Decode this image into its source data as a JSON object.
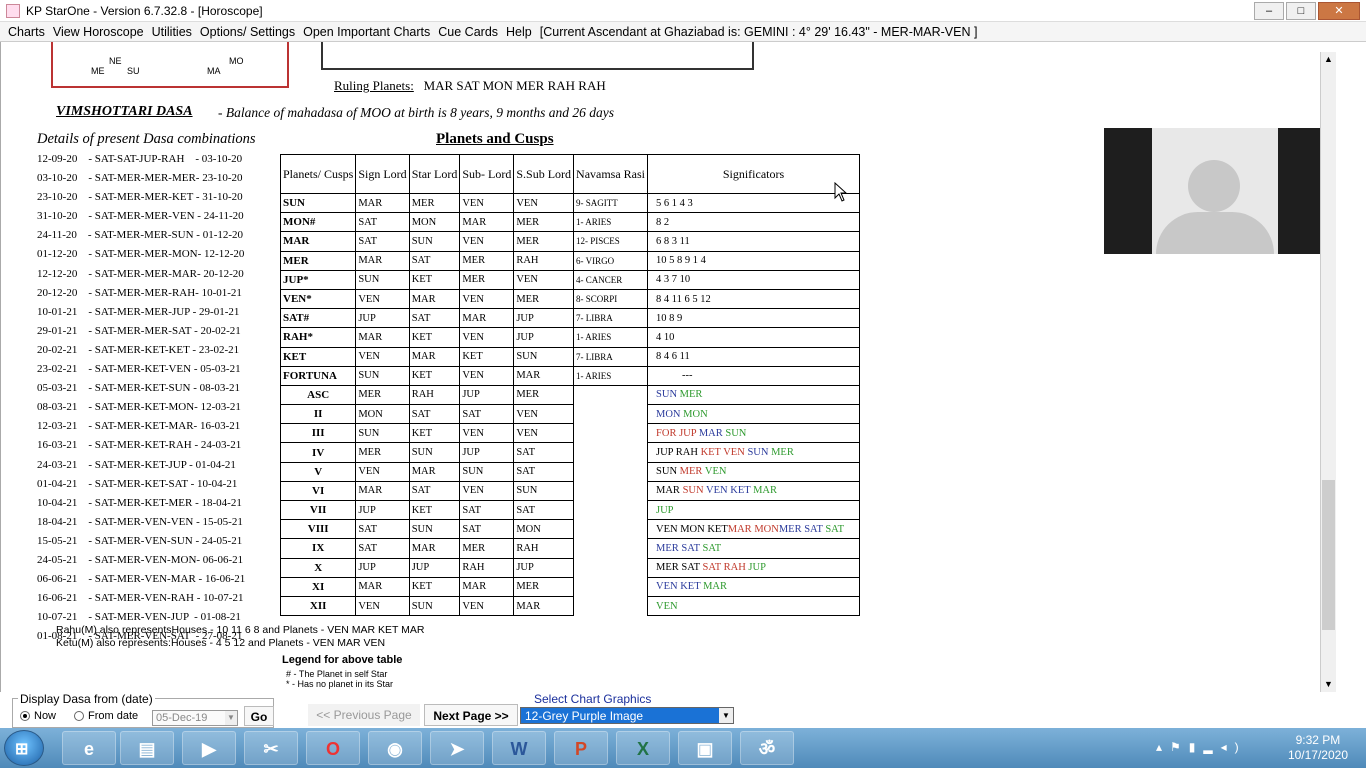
{
  "window": {
    "title": "KP StarOne - Version 6.7.32.8 - [Horoscope]",
    "min": "–",
    "max": "□",
    "close": "✕"
  },
  "menu": [
    "Charts",
    "View Horoscope",
    "Utilities",
    "Options/ Settings",
    "Open Important Charts",
    "Cue Cards",
    "Help",
    "[Current Ascendant at Ghaziabad is: GEMINI   :  4° 29' 16.43\"    -  MER-MAR-VEN ]"
  ],
  "chart_fragment": {
    "labels": [
      "ME",
      "NE",
      "SU",
      "MA",
      "MO"
    ]
  },
  "ruling": {
    "label": "Ruling Planets:",
    "value": "MAR  SAT MON MER RAH  RAH"
  },
  "dasa": {
    "title": "VIMSHOTTARI DASA",
    "balance": "- Balance of mahadasa of MOO at birth is  8 years,  9 months and  26 days",
    "details_title": "Details of present Dasa combinations"
  },
  "dasa_list": [
    "12-09-20    - SAT-SAT-JUP-RAH    - 03-10-20",
    "03-10-20    - SAT-MER-MER-MER- 23-10-20",
    "23-10-20    - SAT-MER-MER-KET - 31-10-20",
    "31-10-20    - SAT-MER-MER-VEN - 24-11-20",
    "24-11-20    - SAT-MER-MER-SUN - 01-12-20",
    "01-12-20    - SAT-MER-MER-MON- 12-12-20",
    "12-12-20    - SAT-MER-MER-MAR- 20-12-20",
    "20-12-20    - SAT-MER-MER-RAH- 10-01-21",
    "10-01-21    - SAT-MER-MER-JUP - 29-01-21",
    "29-01-21    - SAT-MER-MER-SAT - 20-02-21",
    "20-02-21    - SAT-MER-KET-KET - 23-02-21",
    "23-02-21    - SAT-MER-KET-VEN - 05-03-21",
    "05-03-21    - SAT-MER-KET-SUN - 08-03-21",
    "08-03-21    - SAT-MER-KET-MON- 12-03-21",
    "12-03-21    - SAT-MER-KET-MAR- 16-03-21",
    "16-03-21    - SAT-MER-KET-RAH - 24-03-21",
    "24-03-21    - SAT-MER-KET-JUP - 01-04-21",
    "01-04-21    - SAT-MER-KET-SAT - 10-04-21",
    "10-04-21    - SAT-MER-KET-MER - 18-04-21",
    "18-04-21    - SAT-MER-VEN-VEN - 15-05-21",
    "15-05-21    - SAT-MER-VEN-SUN - 24-05-21",
    "24-05-21    - SAT-MER-VEN-MON- 06-06-21",
    "06-06-21    - SAT-MER-VEN-MAR - 16-06-21",
    "16-06-21    - SAT-MER-VEN-RAH - 10-07-21",
    "10-07-21    - SAT-MER-VEN-JUP  - 01-08-21",
    "01-08-21    - SAT-MER-VEN-SAT  - 27-08-21"
  ],
  "pc_title": "Planets and Cusps",
  "pc_headers": [
    "Planets/ Cusps",
    "Sign Lord",
    "Star Lord",
    "Sub- Lord",
    "S.Sub Lord",
    "Navamsa Rasi",
    "Significators"
  ],
  "planets": [
    {
      "name": "SUN",
      "sign": "MAR",
      "star": "MER",
      "sub": "VEN",
      "ssub": "VEN",
      "nav": "9- SAGITT",
      "sig": "5  6  1  4  3"
    },
    {
      "name": "MON#",
      "sign": "SAT",
      "star": "MON",
      "sub": "MAR",
      "ssub": "MER",
      "nav": "1- ARIES",
      "sig": "8  2"
    },
    {
      "name": "MAR",
      "sign": "SAT",
      "star": "SUN",
      "sub": "VEN",
      "ssub": "MER",
      "nav": "12- PISCES",
      "sig": "6  8  3  11"
    },
    {
      "name": "MER",
      "sign": "MAR",
      "star": "SAT",
      "sub": "MER",
      "ssub": "RAH",
      "nav": "6- VIRGO",
      "sig": "10  5  8  9  1  4"
    },
    {
      "name": "JUP*",
      "sign": "SUN",
      "star": "KET",
      "sub": "MER",
      "ssub": "VEN",
      "nav": "4- CANCER",
      "sig": "4  3  7  10"
    },
    {
      "name": "VEN*",
      "sign": "VEN",
      "star": "MAR",
      "sub": "VEN",
      "ssub": "MER",
      "nav": "8- SCORPI",
      "sig": "8  4  11  6  5  12"
    },
    {
      "name": "SAT#",
      "sign": "JUP",
      "star": "SAT",
      "sub": "MAR",
      "ssub": "JUP",
      "nav": "7- LIBRA",
      "sig": "10  8  9"
    },
    {
      "name": "RAH*",
      "sign": "MAR",
      "star": "KET",
      "sub": "VEN",
      "ssub": "JUP",
      "nav": "1- ARIES",
      "sig": "4  10"
    },
    {
      "name": "KET",
      "sign": "VEN",
      "star": "MAR",
      "sub": "KET",
      "ssub": "SUN",
      "nav": "7- LIBRA",
      "sig": "8  4  6  11"
    },
    {
      "name": "FORTUNA",
      "sign": "SUN",
      "star": "KET",
      "sub": "VEN",
      "ssub": "MAR",
      "nav": "1- ARIES",
      "sig": "---"
    }
  ],
  "cusps": [
    {
      "name": "ASC",
      "sign": "MER",
      "star": "RAH",
      "sub": "JUP",
      "ssub": "MER",
      "sig": [
        [
          "SUN ",
          "B"
        ],
        [
          "MER",
          "G"
        ]
      ]
    },
    {
      "name": "II",
      "sign": "MON",
      "star": "SAT",
      "sub": "SAT",
      "ssub": "VEN",
      "sig": [
        [
          "MON ",
          "B"
        ],
        [
          "MON",
          "G"
        ]
      ]
    },
    {
      "name": "III",
      "sign": "SUN",
      "star": "KET",
      "sub": "VEN",
      "ssub": "VEN",
      "sig": [
        [
          "FOR JUP ",
          "R"
        ],
        [
          "MAR ",
          "B"
        ],
        [
          "SUN",
          "G"
        ]
      ]
    },
    {
      "name": "IV",
      "sign": "MER",
      "star": "SUN",
      "sub": "JUP",
      "ssub": "SAT",
      "sig": [
        [
          "JUP RAH ",
          "K"
        ],
        [
          "KET VEN ",
          "R"
        ],
        [
          "SUN ",
          "B"
        ],
        [
          "MER",
          "G"
        ]
      ]
    },
    {
      "name": "V",
      "sign": "VEN",
      "star": "MAR",
      "sub": "SUN",
      "ssub": "SAT",
      "sig": [
        [
          "SUN ",
          "K"
        ],
        [
          "MER ",
          "R"
        ],
        [
          "VEN",
          "G"
        ]
      ]
    },
    {
      "name": "VI",
      "sign": "MAR",
      "star": "SAT",
      "sub": "VEN",
      "ssub": "SUN",
      "sig": [
        [
          "MAR ",
          "K"
        ],
        [
          "SUN ",
          "R"
        ],
        [
          "VEN KET ",
          "B"
        ],
        [
          "MAR",
          "G"
        ]
      ]
    },
    {
      "name": "VII",
      "sign": "JUP",
      "star": "KET",
      "sub": "SAT",
      "ssub": "SAT",
      "sig": [
        [
          "JUP",
          "G"
        ]
      ]
    },
    {
      "name": "VIII",
      "sign": "SAT",
      "star": "SUN",
      "sub": "SAT",
      "ssub": "MON",
      "sig": [
        [
          "VEN MON KET",
          "K"
        ],
        [
          "MAR MON",
          "R"
        ],
        [
          "MER SAT ",
          "B"
        ],
        [
          "SAT",
          "G"
        ]
      ]
    },
    {
      "name": "IX",
      "sign": "SAT",
      "star": "MAR",
      "sub": "MER",
      "ssub": "RAH",
      "sig": [
        [
          "MER SAT ",
          "B"
        ],
        [
          "SAT",
          "G"
        ]
      ]
    },
    {
      "name": "X",
      "sign": "JUP",
      "star": "JUP",
      "sub": "RAH",
      "ssub": "JUP",
      "sig": [
        [
          "MER SAT ",
          "K"
        ],
        [
          "SAT RAH ",
          "R"
        ],
        [
          "JUP",
          "G"
        ]
      ]
    },
    {
      "name": "XI",
      "sign": "MAR",
      "star": "KET",
      "sub": "MAR",
      "ssub": "MER",
      "sig": [
        [
          "VEN KET ",
          "B"
        ],
        [
          "MAR",
          "G"
        ]
      ]
    },
    {
      "name": "XII",
      "sign": "VEN",
      "star": "SUN",
      "sub": "VEN",
      "ssub": "MAR",
      "sig": [
        [
          "VEN",
          "G"
        ]
      ]
    }
  ],
  "notes": {
    "rahu": "Rahu(M) also representsHouses - 10 11 6 8  and Planets -  VEN MAR KET MAR",
    "ketu": "Ketu(M) also represents:Houses - 4 5 12  and Planets -  VEN MAR VEN",
    "legend_title": "Legend for above table",
    "legend_1": "#  - The Planet in self Star",
    "legend_2": "*  - Has no planet in its Star"
  },
  "bottom": {
    "fieldset_label": "Display Dasa from (date)",
    "now": "Now",
    "from_date": "From date",
    "date_value": "05-Dec-19",
    "go": "Go",
    "prev": "<< Previous Page",
    "next": "Next Page >>",
    "select_label": "Select Chart Graphics",
    "select_value": "12-Grey Purple Image"
  },
  "taskbar": {
    "apps": [
      "ie-icon",
      "folder-icon",
      "media-icon",
      "scissors-icon",
      "opera-icon",
      "chrome-icon",
      "telegram-icon",
      "word-icon",
      "powerpoint-icon",
      "excel-icon",
      "zoom-icon",
      "om-icon"
    ],
    "time": "9:32 PM",
    "date": "10/17/2020"
  },
  "colors": {
    "R": "#c0392b",
    "B": "#2b3b9c",
    "G": "#2e9a2e",
    "K": "#000000"
  }
}
